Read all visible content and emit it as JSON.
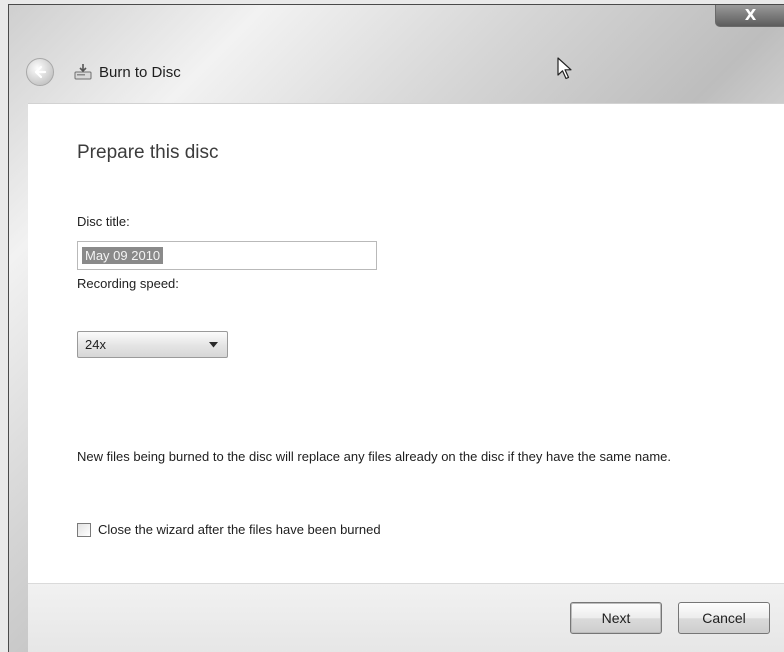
{
  "window": {
    "title": "Burn to Disc",
    "close_glyph": "X"
  },
  "page": {
    "heading": "Prepare this disc",
    "disc_title_label": "Disc title:",
    "disc_title_value": "May 09 2010",
    "recording_speed_label": "Recording speed:",
    "recording_speed_value": "24x",
    "notice_text": "New files being burned to the disc will replace any files already on the disc if they have the same name.",
    "close_wizard_label": "Close the wizard after the files have been burned",
    "close_wizard_checked": false
  },
  "footer": {
    "next_label": "Next",
    "cancel_label": "Cancel"
  },
  "icons": {
    "back": "back-arrow-icon",
    "app": "burn-disc-icon",
    "dropdown": "chevron-down-icon",
    "cursor": "mouse-pointer-icon"
  }
}
